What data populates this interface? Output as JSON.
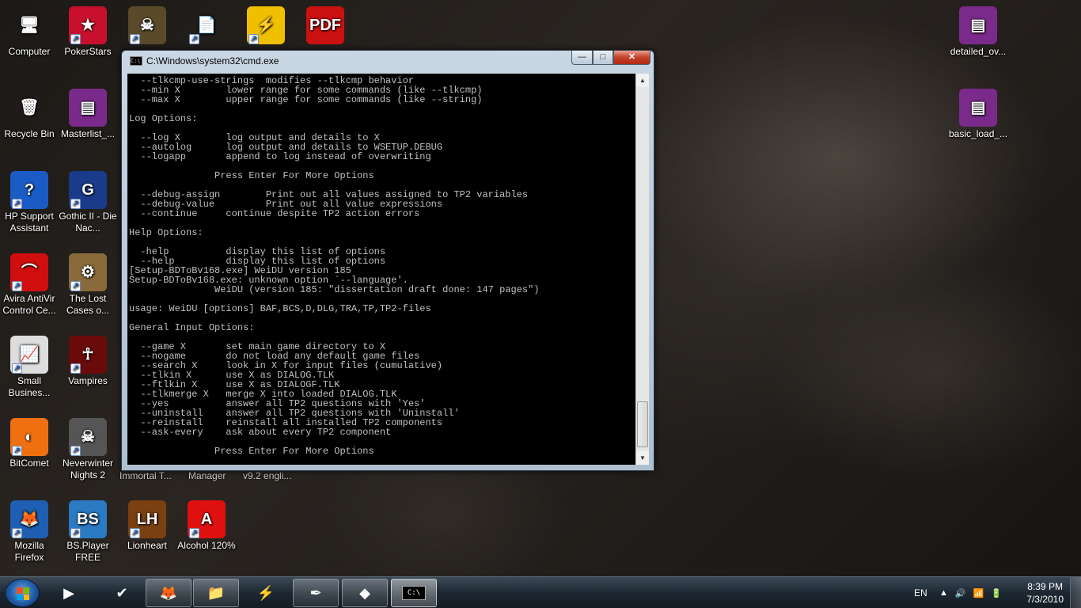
{
  "desktop": {
    "icons": [
      {
        "label": "Computer",
        "glyph": "🖥",
        "bg": "transparent",
        "shortcut": false
      },
      {
        "label": "PokerStars",
        "glyph": "★",
        "bg": "#c8102e",
        "shortcut": true
      },
      {
        "label": "",
        "glyph": "☠",
        "bg": "#5a4a2a",
        "shortcut": true
      },
      {
        "label": "",
        "glyph": "📄",
        "bg": "transparent",
        "shortcut": true
      },
      {
        "label": "",
        "glyph": "⚡",
        "bg": "#f0c000",
        "shortcut": true
      },
      {
        "label": "",
        "glyph": "PDF",
        "bg": "#cc1111",
        "shortcut": false
      },
      {
        "label": "Recycle Bin",
        "glyph": "🗑",
        "bg": "transparent",
        "shortcut": false
      },
      {
        "label": "Masterlist_...",
        "glyph": "▤",
        "bg": "#7a2a8a",
        "shortcut": false
      },
      {
        "label": "HP Support Assistant",
        "glyph": "?",
        "bg": "#1b5bc6",
        "shortcut": true
      },
      {
        "label": "Gothic II - Die Nac...",
        "glyph": "G",
        "bg": "#1a3a8a",
        "shortcut": true
      },
      {
        "label": "Avira AntiVir Control Ce...",
        "glyph": "⌒",
        "bg": "#d10e0e",
        "shortcut": true
      },
      {
        "label": "The Lost Cases o...",
        "glyph": "⚙",
        "bg": "#8a6a3a",
        "shortcut": true
      },
      {
        "label": "Small Busines...",
        "glyph": "📈",
        "bg": "#dddddd",
        "shortcut": true
      },
      {
        "label": "Vampires",
        "glyph": "☥",
        "bg": "#6a0a0a",
        "shortcut": true
      },
      {
        "label": "BitComet",
        "glyph": "◐",
        "bg": "#f07010",
        "shortcut": true
      },
      {
        "label": "Neverwinter Nights 2",
        "glyph": "☠",
        "bg": "#555555",
        "shortcut": true
      },
      {
        "label": "Mozilla Firefox",
        "glyph": "🦊",
        "bg": "#1e5fb4",
        "shortcut": true
      },
      {
        "label": "BS.Player FREE",
        "glyph": "BS",
        "bg": "#2a7ac4",
        "shortcut": true
      },
      {
        "label": "Lionheart",
        "glyph": "LH",
        "bg": "#7a4010",
        "shortcut": true
      },
      {
        "label": "Alcohol 120%",
        "glyph": "A",
        "bg": "#e01010",
        "shortcut": true
      },
      {
        "label": "detailed_ov...",
        "glyph": "▤",
        "bg": "#7a2a8a",
        "shortcut": false
      },
      {
        "label": "basic_load_...",
        "glyph": "▤",
        "bg": "#7a2a8a",
        "shortcut": false
      }
    ],
    "behind_labels": [
      "Immortal T...",
      "Manager",
      "v9.2 engli..."
    ]
  },
  "window": {
    "title": "C:\\Windows\\system32\\cmd.exe",
    "icon": "cmd-icon",
    "buttons": {
      "minimize": "—",
      "maximize": "□",
      "close": "✕"
    },
    "console_lines": [
      "  --tlkcmp-use-strings  modifies --tlkcmp behavior",
      "  --min X        lower range for some commands (like --tlkcmp)",
      "  --max X        upper range for some commands (like --string)",
      "",
      "Log Options:",
      "",
      "  --log X        log output and details to X",
      "  --autolog      log output and details to WSETUP.DEBUG",
      "  --logapp       append to log instead of overwriting",
      "",
      "               Press Enter For More Options",
      "",
      "  --debug-assign        Print out all values assigned to TP2 variables",
      "  --debug-value         Print out all value expressions",
      "  --continue     continue despite TP2 action errors",
      "",
      "Help Options:",
      "",
      "  -help          display this list of options",
      "  --help         display this list of options",
      "[Setup-BDToBv168.exe] WeiDU version 185",
      "Setup-BDToBv168.exe: unknown option `--language'.",
      "               WeiDU (version 185: \"dissertation draft done: 147 pages\")",
      "",
      "usage: WeiDU [options] BAF,BCS,D,DLG,TRA,TP,TP2-files",
      "",
      "General Input Options:",
      "",
      "  --game X       set main game directory to X",
      "  --nogame       do not load any default game files",
      "  --search X     look in X for input files (cumulative)",
      "  --tlkin X      use X as DIALOG.TLK",
      "  --ftlkin X     use X as DIALOGF.TLK",
      "  --tlkmerge X   merge X into loaded DIALOG.TLK",
      "  --yes          answer all TP2 questions with 'Yes'",
      "  --uninstall    answer all TP2 questions with 'Uninstall'",
      "  --reinstall    reinstall all installed TP2 components",
      "  --ask-every    ask about every TP2 component",
      "",
      "               Press Enter For More Options"
    ],
    "scroll": {
      "up": "▲",
      "down": "▼"
    }
  },
  "taskbar": {
    "buttons": [
      {
        "name": "media-player-button",
        "glyph": "▶",
        "state": ""
      },
      {
        "name": "check-app-button",
        "glyph": "✔",
        "state": ""
      },
      {
        "name": "firefox-button",
        "glyph": "🦊",
        "state": "open"
      },
      {
        "name": "explorer-button",
        "glyph": "📁",
        "state": "open"
      },
      {
        "name": "winamp-button",
        "glyph": "⚡",
        "state": ""
      },
      {
        "name": "adobe-reader-button",
        "glyph": "✒",
        "state": "open"
      },
      {
        "name": "notes-button",
        "glyph": "◆",
        "state": "open"
      },
      {
        "name": "cmd-button",
        "glyph": "C:\\",
        "state": "active"
      }
    ],
    "language": "EN",
    "tray_icons": [
      "▲",
      "🔊",
      "📶",
      "🔋"
    ],
    "time": "8:39 PM",
    "date": "7/3/2010"
  },
  "colors": {
    "console_bg": "#000000",
    "console_fg": "#c0c0c0",
    "close_button": "#c4402a"
  }
}
